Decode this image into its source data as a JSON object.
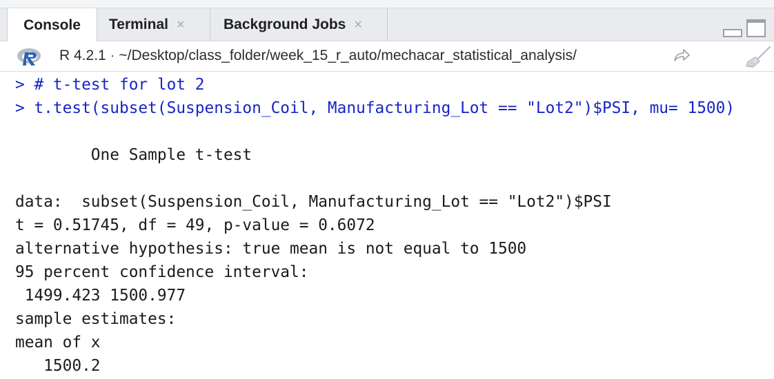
{
  "tabs": [
    {
      "label": "Console",
      "closable": false,
      "active": true
    },
    {
      "label": "Terminal",
      "closable": true,
      "active": false
    },
    {
      "label": "Background Jobs",
      "closable": true,
      "active": false
    }
  ],
  "close_glyph": "×",
  "infobar": {
    "r_version": "R 4.2.1",
    "separator": "·",
    "path": "~/Desktop/class_folder/week_15_r_auto/mechacar_statistical_analysis/"
  },
  "icons": {
    "r_logo": "r-logo-icon",
    "goto_dir": "goto-directory-icon",
    "clear_console": "broom-icon",
    "minimize": "minimize-pane-icon",
    "maximize": "maximize-pane-icon"
  },
  "colors": {
    "command_text": "#1725c7",
    "output_text": "#1b1b1b",
    "tabbar_bg": "#e9ebee"
  },
  "console": {
    "lines": [
      {
        "type": "command",
        "text": "> # t-test for lot 2"
      },
      {
        "type": "command",
        "text": "> t.test(subset(Suspension_Coil, Manufacturing_Lot == \"Lot2\")$PSI, mu= 1500)"
      },
      {
        "type": "blank",
        "text": ""
      },
      {
        "type": "output",
        "text": "        One Sample t-test"
      },
      {
        "type": "blank",
        "text": ""
      },
      {
        "type": "output",
        "text": "data:  subset(Suspension_Coil, Manufacturing_Lot == \"Lot2\")$PSI"
      },
      {
        "type": "output",
        "text": "t = 0.51745, df = 49, p-value = 0.6072"
      },
      {
        "type": "output",
        "text": "alternative hypothesis: true mean is not equal to 1500"
      },
      {
        "type": "output",
        "text": "95 percent confidence interval:"
      },
      {
        "type": "output",
        "text": " 1499.423 1500.977"
      },
      {
        "type": "output",
        "text": "sample estimates:"
      },
      {
        "type": "output",
        "text": "mean of x"
      },
      {
        "type": "output",
        "text": "   1500.2"
      }
    ]
  }
}
